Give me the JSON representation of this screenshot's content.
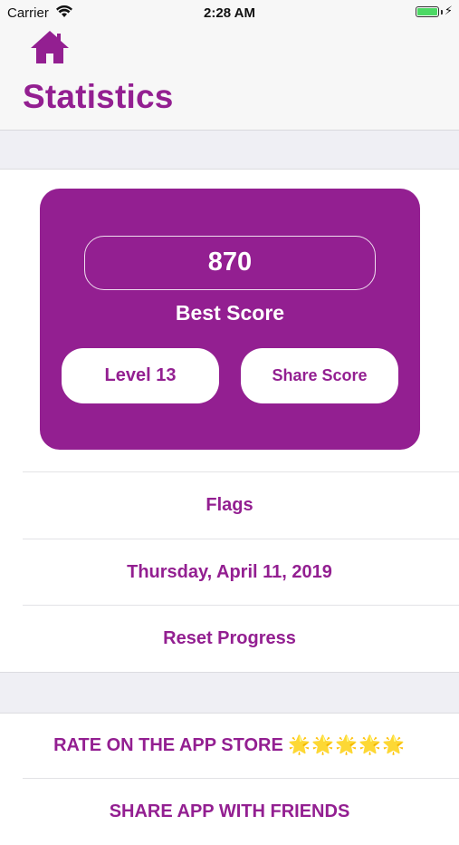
{
  "status_bar": {
    "carrier": "Carrier",
    "time": "2:28 AM",
    "battery_color": "#4cd964"
  },
  "nav": {
    "home_icon": "home-icon",
    "title": "Statistics"
  },
  "theme": {
    "accent": "#931f91",
    "background": "#ffffff",
    "section_gap": "#efeff4"
  },
  "score_card": {
    "score": "870",
    "label": "Best Score",
    "level_button": "Level 13",
    "share_button": "Share Score"
  },
  "list": {
    "flags": "Flags",
    "date": "Thursday, April 11, 2019",
    "reset": "Reset Progress"
  },
  "actions": {
    "rate": "RATE ON THE APP STORE",
    "rate_stars": "🌟🌟🌟🌟🌟",
    "share_app": "SHARE APP WITH FRIENDS"
  }
}
